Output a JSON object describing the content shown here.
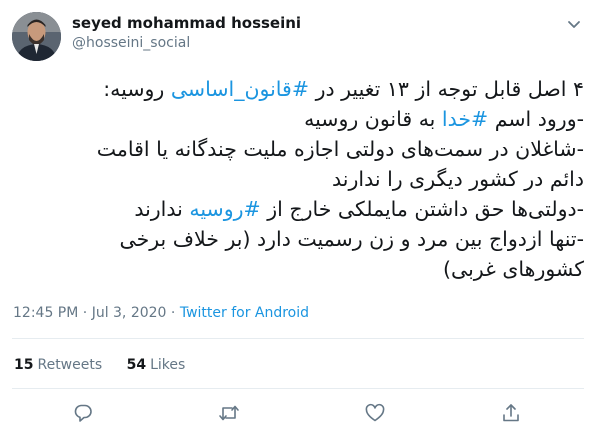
{
  "author": {
    "display_name": "seyed mohammad hosseini",
    "handle": "@hosseini_social"
  },
  "tweet": {
    "lines": [
      [
        {
          "t": "۴ اصل قابل توجه از ۱۳ تغییر در ",
          "h": false
        },
        {
          "t": "#قانون_اساسی",
          "h": true
        },
        {
          "t": " روسیه:",
          "h": false
        }
      ],
      [
        {
          "t": "-ورود اسم ",
          "h": false
        },
        {
          "t": "#خدا",
          "h": true
        },
        {
          "t": " به قانون روسیه",
          "h": false
        }
      ],
      [
        {
          "t": "-شاغلان در سمت‌های دولتی اجازه ملیت چندگانه یا اقامت",
          "h": false
        }
      ],
      [
        {
          "t": "دائم در کشور دیگری را ندارند",
          "h": false
        }
      ],
      [
        {
          "t": "-دولتی‌ها حق داشتن مایملکی خارج از ",
          "h": false
        },
        {
          "t": "#روسیه",
          "h": true
        },
        {
          "t": " ندارند",
          "h": false
        }
      ],
      [
        {
          "t": "-تنها ازدواج بین مرد و زن رسمیت دارد (بر خلاف برخی",
          "h": false
        }
      ],
      [
        {
          "t": "کشورهای غربی)",
          "h": false
        }
      ]
    ]
  },
  "meta": {
    "time": "12:45 PM",
    "separator": "·",
    "date": "Jul 3, 2020",
    "source": "Twitter for Android"
  },
  "stats": {
    "retweets_count": "15",
    "retweets_label": "Retweets",
    "likes_count": "54",
    "likes_label": "Likes"
  },
  "icons": {
    "caret": "chevron-down-icon",
    "reply": "reply-icon",
    "retweet": "retweet-icon",
    "like": "heart-icon",
    "share": "share-icon"
  },
  "colors": {
    "link": "#1b95e0",
    "text": "#14171a",
    "muted": "#657786",
    "divider": "#e6ecf0"
  }
}
